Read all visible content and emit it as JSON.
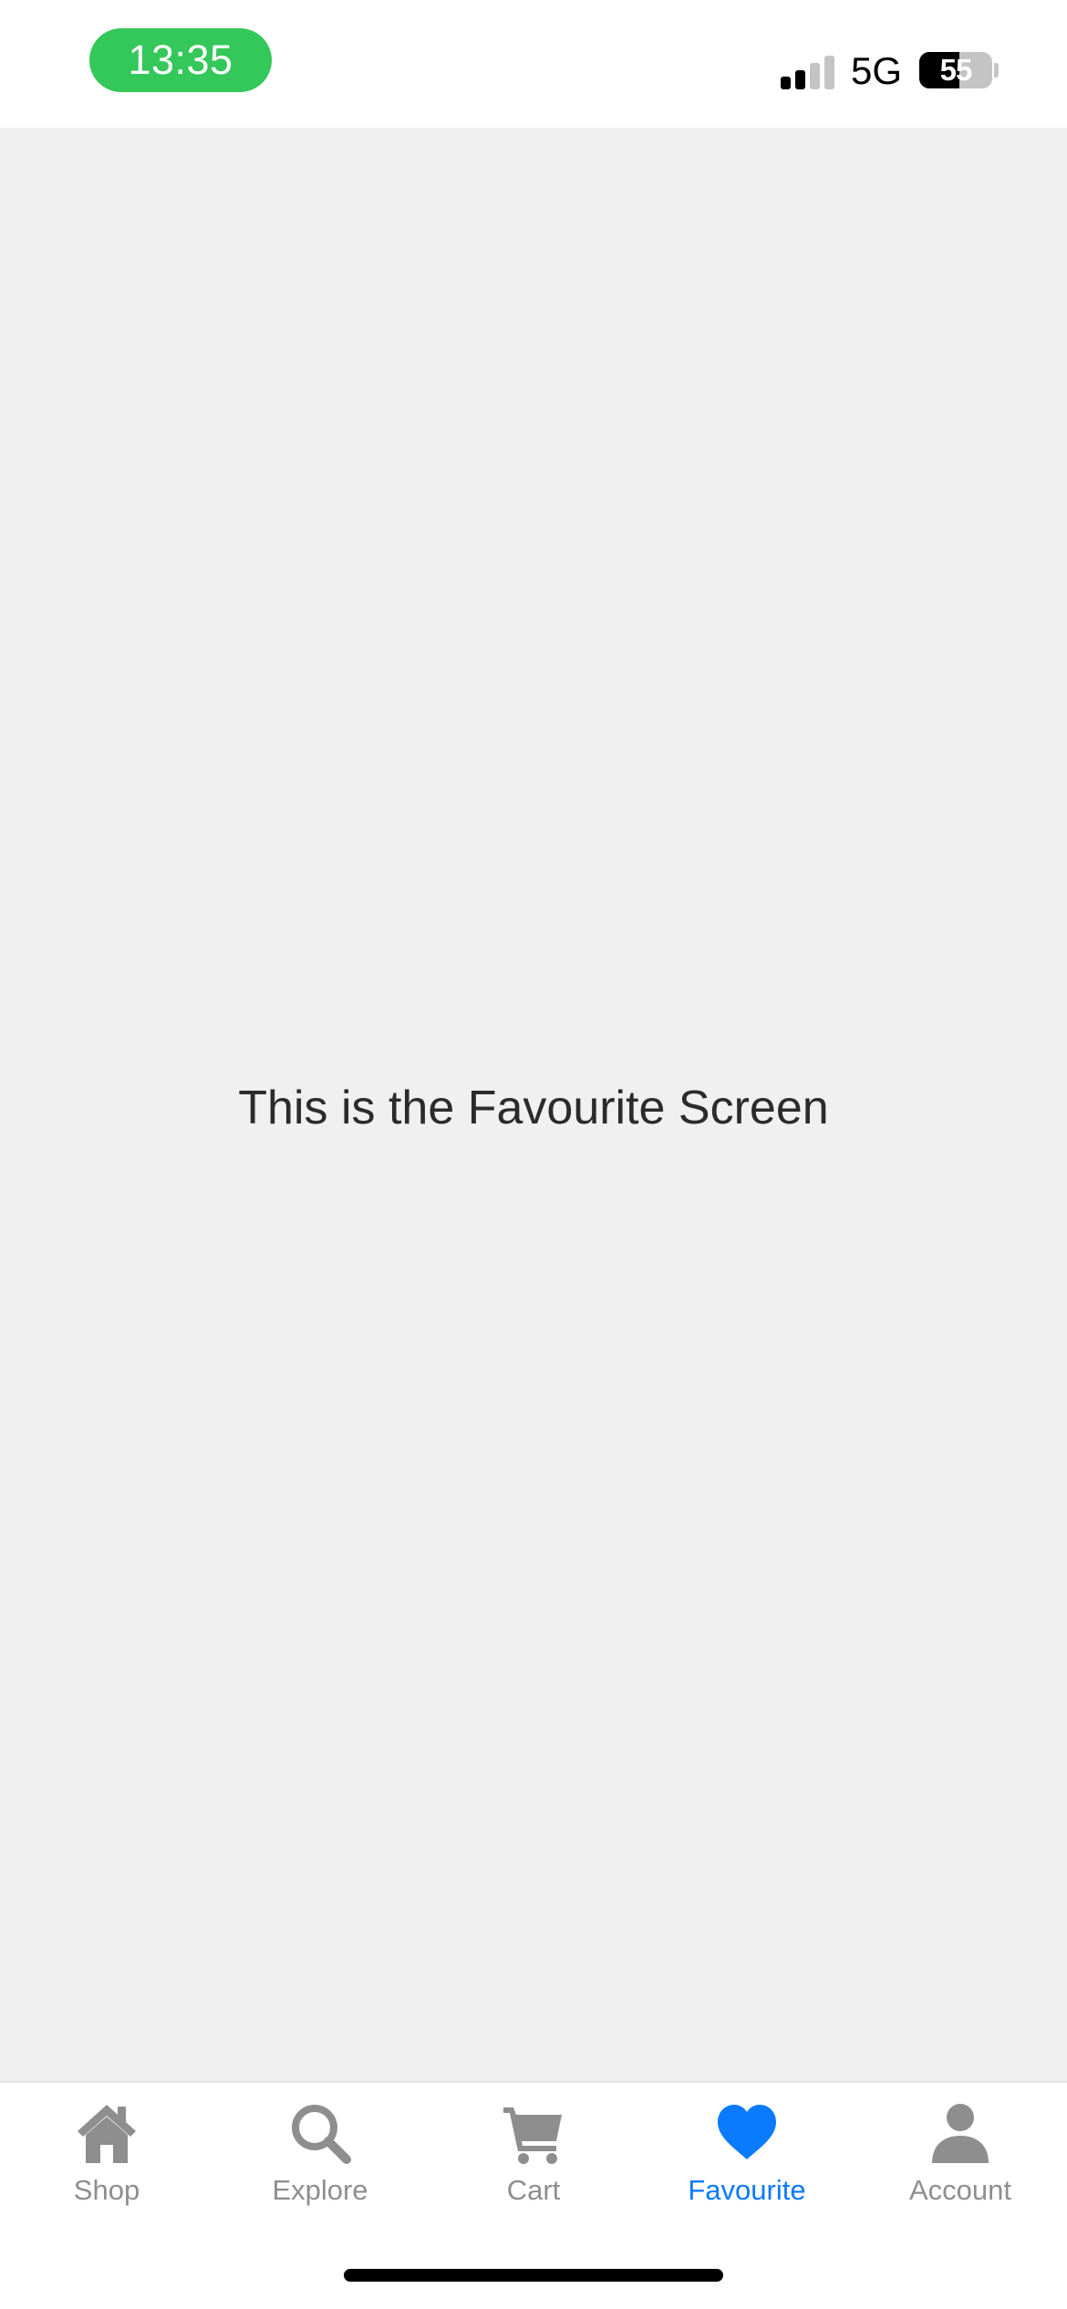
{
  "status_bar": {
    "time": "13:35",
    "time_pill_color": "#34c759",
    "signal_bars": 4,
    "signal_bars_active": 2,
    "network": "5G",
    "battery_level": 55,
    "battery_text": "55"
  },
  "main": {
    "message": "This is the Favourite Screen"
  },
  "tab_bar": {
    "active_color": "#0a7aff",
    "inactive_color": "#8e8e8e",
    "tabs": [
      {
        "label": "Shop",
        "icon": "home-icon",
        "active": false
      },
      {
        "label": "Explore",
        "icon": "search-icon",
        "active": false
      },
      {
        "label": "Cart",
        "icon": "cart-icon",
        "active": false
      },
      {
        "label": "Favourite",
        "icon": "heart-icon",
        "active": true
      },
      {
        "label": "Account",
        "icon": "person-icon",
        "active": false
      }
    ]
  }
}
